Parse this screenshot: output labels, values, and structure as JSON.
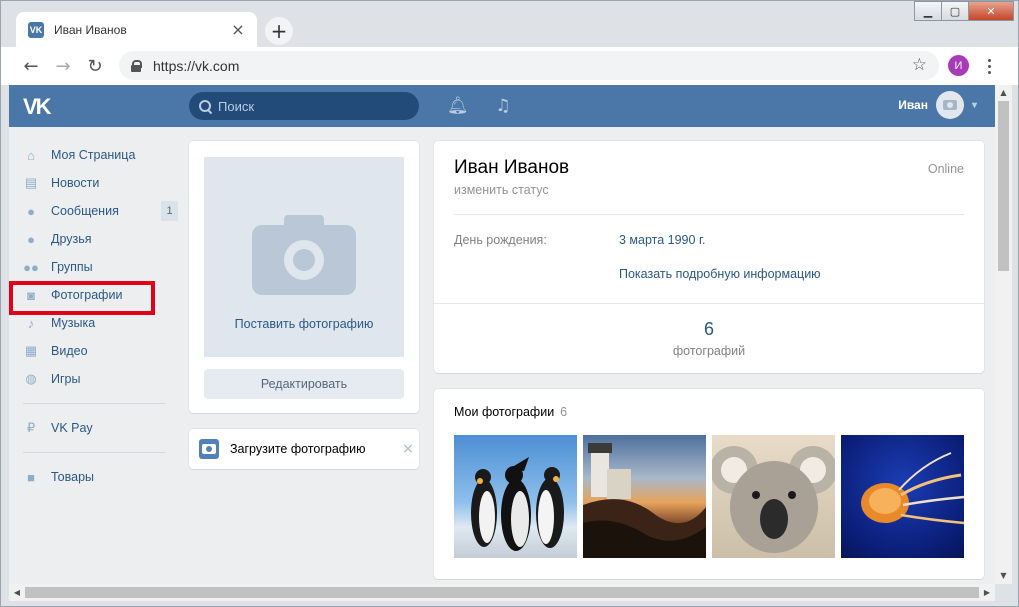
{
  "browser": {
    "tab_title": "Иван Иванов",
    "tab_favicon": "VK",
    "url": "https://vk.com",
    "profile_initial": "И",
    "accent_color": "#4a76a8"
  },
  "vk": {
    "logo": "VK",
    "search_placeholder": "Поиск",
    "user_name": "Иван",
    "icons": [
      "bell-icon",
      "music-note-icon"
    ]
  },
  "menu": {
    "items": [
      {
        "label": "Моя Страница",
        "icon": "home-icon"
      },
      {
        "label": "Новости",
        "icon": "news-icon"
      },
      {
        "label": "Сообщения",
        "icon": "message-icon",
        "badge": "1"
      },
      {
        "label": "Друзья",
        "icon": "person-icon"
      },
      {
        "label": "Группы",
        "icon": "group-icon"
      },
      {
        "label": "Фотографии",
        "icon": "camera-icon"
      },
      {
        "label": "Музыка",
        "icon": "music-icon"
      },
      {
        "label": "Видео",
        "icon": "film-icon"
      },
      {
        "label": "Игры",
        "icon": "gamepad-icon"
      }
    ],
    "extra": [
      {
        "label": "VK Pay",
        "icon": "ruble-icon"
      },
      {
        "label": "Товары",
        "icon": "bag-icon"
      }
    ]
  },
  "photo_card": {
    "placeholder_label": "Поставить фотографию",
    "edit_label": "Редактировать"
  },
  "upload": {
    "label": "Загрузите фотографию",
    "close": "×"
  },
  "profile": {
    "name": "Иван Иванов",
    "online": "Online",
    "status": "изменить статус",
    "birthday_label": "День рождения:",
    "birthday_value": "3 марта 1990 г.",
    "more_info": "Показать подробную информацию",
    "photo_count": "6",
    "photo_count_label": "фотографий"
  },
  "my_photos": {
    "title": "Мои фотографии",
    "count": "6"
  }
}
